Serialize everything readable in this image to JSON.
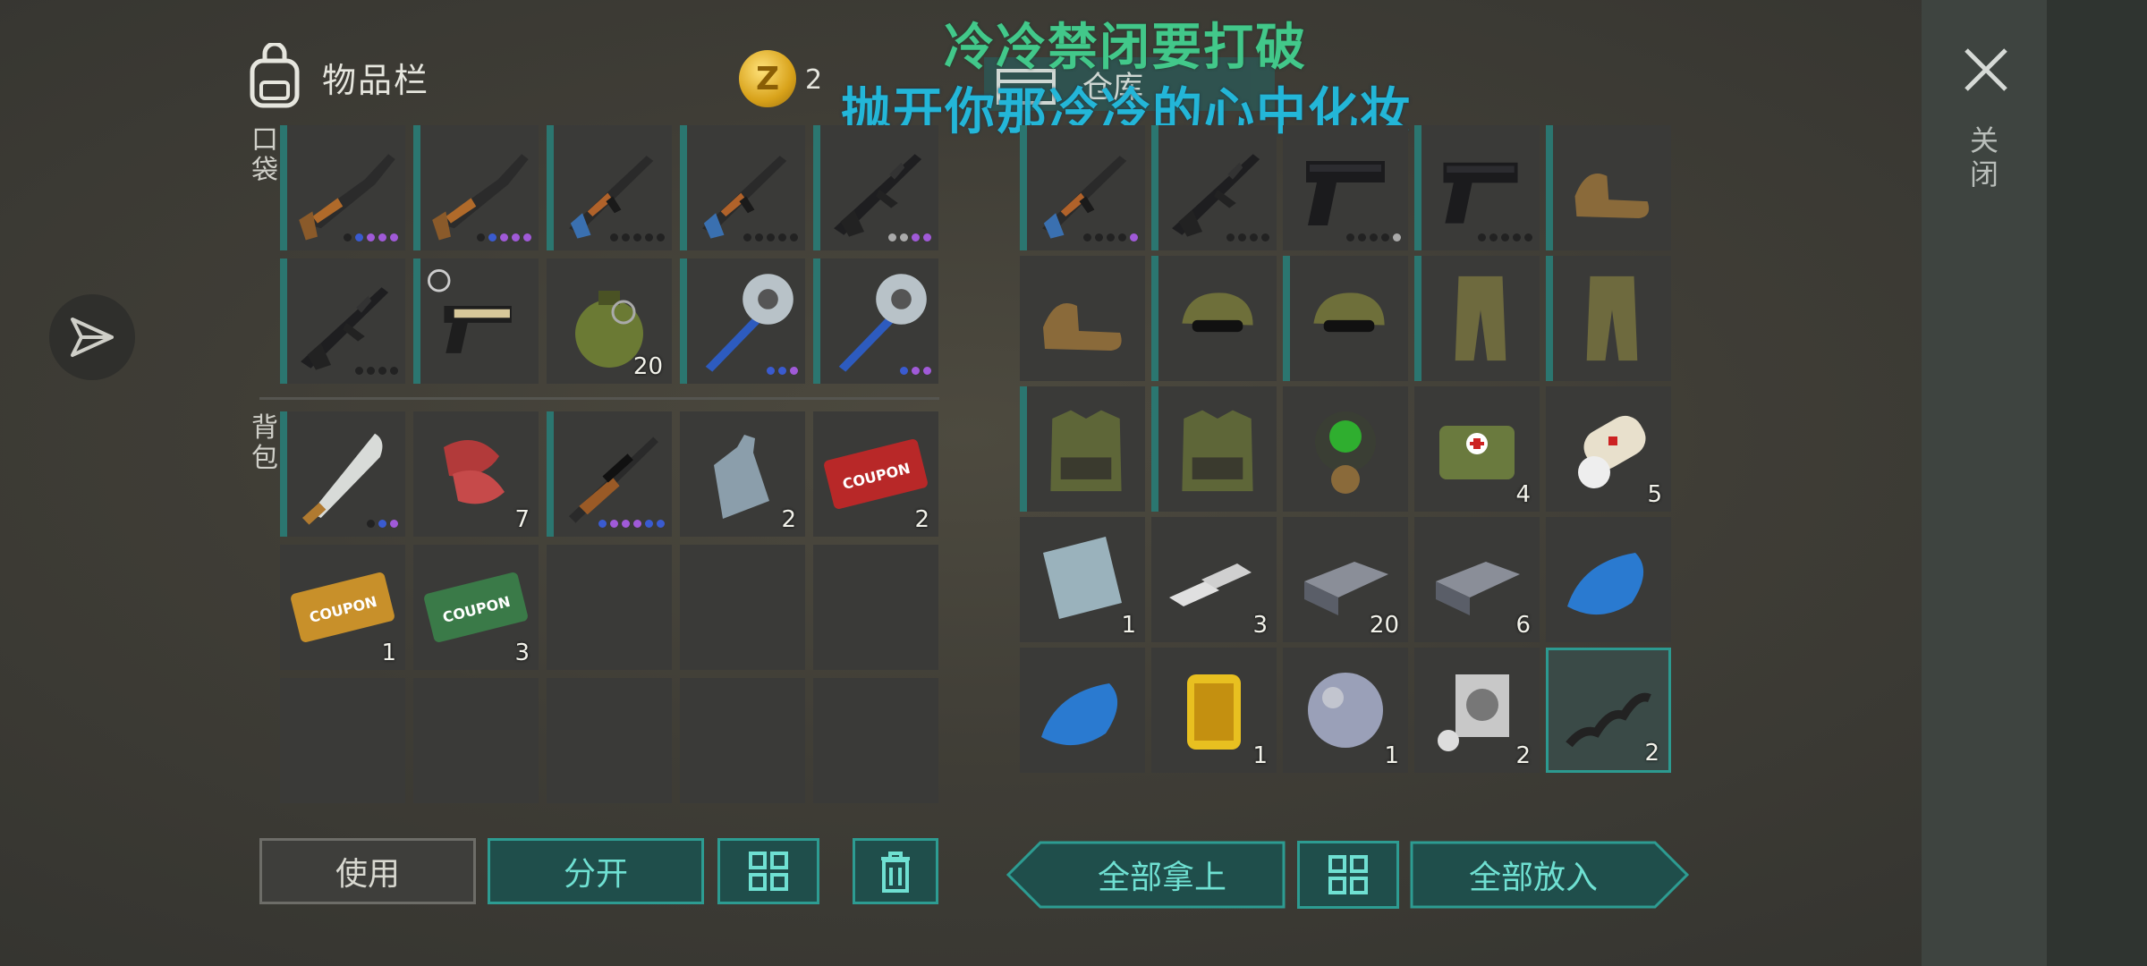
{
  "inventory": {
    "title": "物品栏",
    "pocket_label": "口袋",
    "backpack_label": "背包"
  },
  "currency": {
    "coin_symbol": "Z",
    "amount": "2"
  },
  "storage": {
    "title": "仓库"
  },
  "lyrics": {
    "line1": "冷冷禁闭要打破",
    "line2": "抛开你那冷冷的心中化妆"
  },
  "close_label": "关闭",
  "pocket": [
    {
      "name": "shotgun",
      "qty": "",
      "dots": [
        "#222",
        "#3a5bd0",
        "#a05ad8",
        "#a05ad8",
        "#a05ad8"
      ],
      "hl": true
    },
    {
      "name": "shotgun",
      "qty": "",
      "dots": [
        "#222",
        "#3a5bd0",
        "#a05ad8",
        "#a05ad8",
        "#a05ad8"
      ],
      "hl": true
    },
    {
      "name": "ak-rifle",
      "qty": "",
      "dots": [
        "#222",
        "#222",
        "#222",
        "#222",
        "#222"
      ],
      "hl": true
    },
    {
      "name": "ak-rifle",
      "qty": "",
      "dots": [
        "#222",
        "#222",
        "#222",
        "#222",
        "#222"
      ],
      "hl": true
    },
    {
      "name": "m16-rifle",
      "qty": "",
      "dots": [
        "#aaa",
        "#aaa",
        "#a05ad8",
        "#a05ad8"
      ],
      "hl": true
    },
    {
      "name": "m16-rifle",
      "qty": "",
      "dots": [
        "#222",
        "#222",
        "#222",
        "#222"
      ],
      "hl": true
    },
    {
      "name": "pistol-gold",
      "qty": "",
      "dots": [],
      "hl": true
    },
    {
      "name": "grenade",
      "qty": "20",
      "dots": [],
      "hl": false
    },
    {
      "name": "saw-mace",
      "qty": "",
      "dots": [
        "#3a5bd0",
        "#3a5bd0",
        "#a05ad8"
      ],
      "hl": true
    },
    {
      "name": "saw-mace",
      "qty": "",
      "dots": [
        "#3a5bd0",
        "#a05ad8",
        "#a05ad8"
      ],
      "hl": true
    }
  ],
  "backpack": [
    {
      "name": "machete",
      "qty": "",
      "dots": [
        "#222",
        "#3a5bd0",
        "#a05ad8"
      ],
      "hl": true
    },
    {
      "name": "raw-meat",
      "qty": "7",
      "dots": [],
      "hl": false
    },
    {
      "name": "sniper-rifle",
      "qty": "",
      "dots": [
        "#3a5bd0",
        "#a05ad8",
        "#a05ad8",
        "#a05ad8",
        "#3a5bd0",
        "#3a5bd0"
      ],
      "hl": true
    },
    {
      "name": "water-bottle",
      "qty": "2",
      "dots": [],
      "hl": false
    },
    {
      "name": "combat-gear-coupon",
      "qty": "2",
      "dots": [],
      "hl": false,
      "text": "COUPON"
    },
    {
      "name": "survival-kit-coupon",
      "qty": "1",
      "dots": [],
      "hl": false,
      "text": "COUPON"
    },
    {
      "name": "ration-coupon",
      "qty": "3",
      "dots": [],
      "hl": false,
      "text": "COUPON"
    },
    {
      "name": "empty",
      "qty": "",
      "dots": [],
      "hl": false
    },
    {
      "name": "empty",
      "qty": "",
      "dots": [],
      "hl": false
    },
    {
      "name": "empty",
      "qty": "",
      "dots": [],
      "hl": false
    },
    {
      "name": "empty",
      "qty": "",
      "dots": [],
      "hl": false
    },
    {
      "name": "empty",
      "qty": "",
      "dots": [],
      "hl": false
    },
    {
      "name": "empty",
      "qty": "",
      "dots": [],
      "hl": false
    },
    {
      "name": "empty",
      "qty": "",
      "dots": [],
      "hl": false
    },
    {
      "name": "empty",
      "qty": "",
      "dots": [],
      "hl": false
    }
  ],
  "storage_items": [
    {
      "name": "ak-rifle",
      "qty": "",
      "dots": [
        "#222",
        "#222",
        "#222",
        "#222",
        "#a05ad8"
      ],
      "hl": true
    },
    {
      "name": "m16-rifle",
      "qty": "",
      "dots": [
        "#222",
        "#222",
        "#222",
        "#222"
      ],
      "hl": true
    },
    {
      "name": "pistol",
      "qty": "",
      "dots": [
        "#222",
        "#222",
        "#222",
        "#222",
        "#aaa"
      ],
      "hl": false
    },
    {
      "name": "pistol",
      "qty": "",
      "dots": [
        "#222",
        "#222",
        "#222",
        "#222",
        "#222"
      ],
      "hl": true
    },
    {
      "name": "boots",
      "qty": "",
      "dots": [],
      "hl": true
    },
    {
      "name": "boots",
      "qty": "",
      "dots": [],
      "hl": false
    },
    {
      "name": "camo-cap",
      "qty": "",
      "dots": [],
      "hl": true
    },
    {
      "name": "camo-cap",
      "qty": "",
      "dots": [],
      "hl": true
    },
    {
      "name": "camo-pants",
      "qty": "",
      "dots": [],
      "hl": true
    },
    {
      "name": "camo-pants",
      "qty": "",
      "dots": [],
      "hl": true
    },
    {
      "name": "camo-vest",
      "qty": "",
      "dots": [],
      "hl": true
    },
    {
      "name": "camo-vest",
      "qty": "",
      "dots": [],
      "hl": true
    },
    {
      "name": "gas-mask",
      "qty": "",
      "dots": [],
      "hl": false
    },
    {
      "name": "medkit",
      "qty": "4",
      "dots": [],
      "hl": false
    },
    {
      "name": "bandage",
      "qty": "5",
      "dots": [],
      "hl": false
    },
    {
      "name": "metal-plate",
      "qty": "1",
      "dots": [],
      "hl": false
    },
    {
      "name": "aluminum-bars",
      "qty": "3",
      "dots": [],
      "hl": false
    },
    {
      "name": "iron-ingot",
      "qty": "20",
      "dots": [],
      "hl": false
    },
    {
      "name": "iron-ingot",
      "qty": "6",
      "dots": [],
      "hl": false
    },
    {
      "name": "fuel-tank",
      "qty": "",
      "dots": [],
      "hl": false
    },
    {
      "name": "fuel-tank",
      "qty": "",
      "dots": [],
      "hl": false
    },
    {
      "name": "air-filter",
      "qty": "1",
      "dots": [],
      "hl": false
    },
    {
      "name": "glass-lens",
      "qty": "1",
      "dots": [],
      "hl": false
    },
    {
      "name": "engine-cylinder",
      "qty": "2",
      "dots": [],
      "hl": false
    },
    {
      "name": "spring",
      "qty": "2",
      "dots": [],
      "hl": false,
      "selected": true
    }
  ],
  "buttons": {
    "use": "使用",
    "split": "分开",
    "take_all": "全部拿上",
    "put_all": "全部放入"
  }
}
